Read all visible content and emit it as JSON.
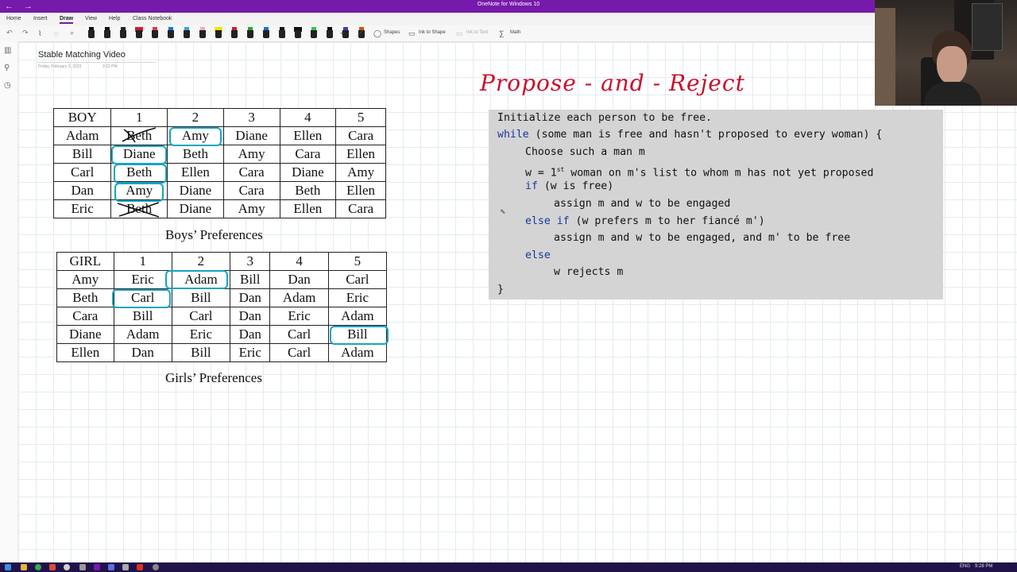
{
  "window": {
    "title": "OneNote for Windows 10",
    "nav_back": "←",
    "nav_forward": "→"
  },
  "menu": {
    "tabs": [
      "Home",
      "Insert",
      "Draw",
      "View",
      "Help",
      "Class Notebook"
    ],
    "active_tab": "Draw"
  },
  "toolbar": {
    "undo": "↶",
    "redo": "↷",
    "shapes_label": "Shapes",
    "ink_to_shape_label": "Ink to Shape",
    "ink_to_text_label": "Ink to Text",
    "math_label": "Math",
    "pen_colors": [
      "#111111",
      "#111111",
      "#222222",
      "#cc1f2f",
      "#e23b3b",
      "#1b75d0",
      "#2ea8e0",
      "#f2a7c5",
      "#f5e400",
      "#cc1f2f",
      "#22aa22",
      "#1b75d0",
      "#111111",
      "#111111",
      "#2ecc40",
      "#111111",
      "#3f3fbf",
      "#d35400"
    ]
  },
  "page": {
    "title": "Stable Matching Video",
    "date": "Friday, February 3, 2023",
    "time": "9:22 PM"
  },
  "boys_table": {
    "header": [
      "BOY",
      "1",
      "2",
      "3",
      "4",
      "5"
    ],
    "rows": [
      [
        "Adam",
        "Beth",
        "Amy",
        "Diane",
        "Ellen",
        "Cara"
      ],
      [
        "Bill",
        "Diane",
        "Beth",
        "Amy",
        "Cara",
        "Ellen"
      ],
      [
        "Carl",
        "Beth",
        "Ellen",
        "Cara",
        "Diane",
        "Amy"
      ],
      [
        "Dan",
        "Amy",
        "Diane",
        "Cara",
        "Beth",
        "Ellen"
      ],
      [
        "Eric",
        "Beth",
        "Diane",
        "Amy",
        "Ellen",
        "Cara"
      ]
    ],
    "caption": "Boys’ Preferences"
  },
  "girls_table": {
    "header": [
      "GIRL",
      "1",
      "2",
      "3",
      "4",
      "5"
    ],
    "rows": [
      [
        "Amy",
        "Eric",
        "Adam",
        "Bill",
        "Dan",
        "Carl"
      ],
      [
        "Beth",
        "Carl",
        "Bill",
        "Dan",
        "Adam",
        "Eric"
      ],
      [
        "Cara",
        "Bill",
        "Carl",
        "Dan",
        "Eric",
        "Adam"
      ],
      [
        "Diane",
        "Adam",
        "Eric",
        "Dan",
        "Carl",
        "Bill"
      ],
      [
        "Ellen",
        "Dan",
        "Bill",
        "Eric",
        "Carl",
        "Adam"
      ]
    ],
    "caption": "Girls’ Preferences"
  },
  "handwritten_title": "Propose - and - Reject",
  "algorithm": {
    "line1": "Initialize each person to be free.",
    "line2_kw": "while",
    "line2_rest": " (some man is free and hasn't proposed to every woman) {",
    "line3": "Choose such a man m",
    "line4_a": "w = 1",
    "line4_sup": "st",
    "line4_b": " woman on m's list to whom m has not yet proposed",
    "line5_kw": "if",
    "line5_rest": " (w is free)",
    "line6": "assign m and w to be engaged",
    "line7_kw": "else if",
    "line7_rest": " (w prefers m to her fiancé m')",
    "line8": "assign m and w to be engaged, and m' to be free",
    "line9_kw": "else",
    "line10": "w rejects m",
    "line11": "}"
  },
  "taskbar": {
    "lang": "ENG",
    "time": "9:28 PM"
  }
}
